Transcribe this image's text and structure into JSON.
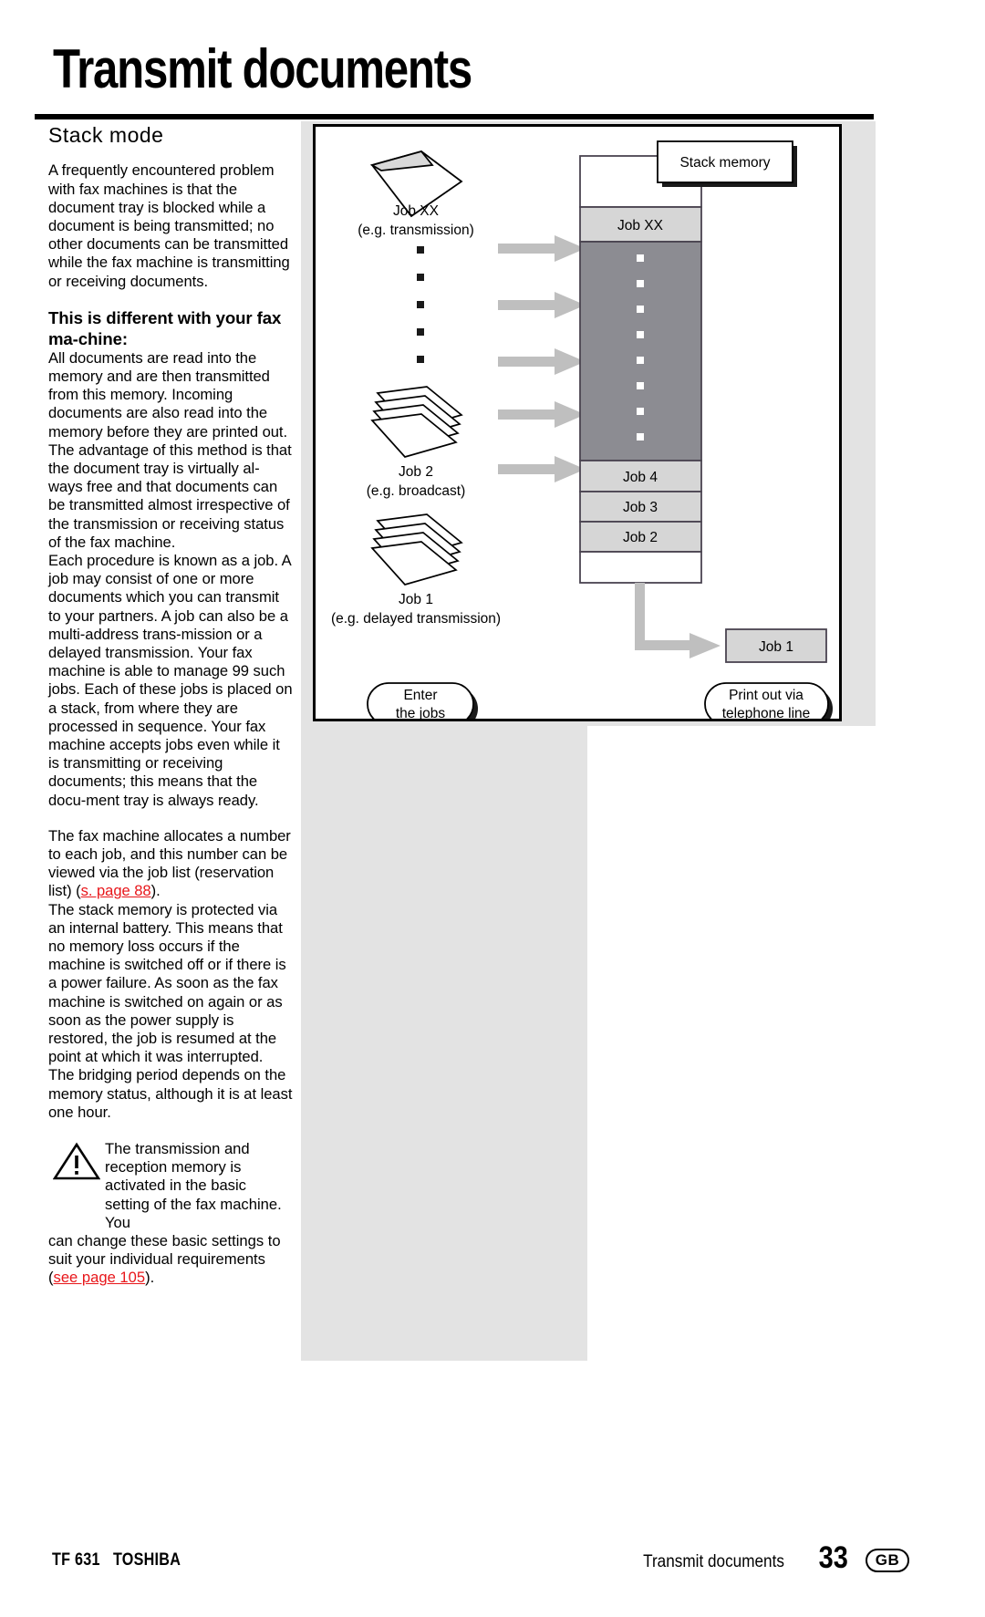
{
  "header": {
    "title": "Transmit documents"
  },
  "left_column": {
    "section_heading": "Stack mode",
    "paragraph_1": "A frequently encountered problem with fax machines is that the document tray is blocked while a document is being transmitted; no other documents can be transmitted while the fax machine is transmitting or receiving documents.",
    "sub_heading": "This is different with your fax ma-chine:",
    "paragraph_2": "All documents are read into the memory and are then transmitted from this memory. Incoming documents are also read into the memory before they are printed out. The advantage of this method is that the document tray is virtually al-ways free and that documents can be transmitted almost irrespective of the transmission or receiving status of the fax machine.",
    "paragraph_3": "Each procedure is known as a job. A job may consist of one or more documents which you can transmit to your partners. A job can also be a multi-address trans-mission or a delayed transmission. Your fax machine is able to manage 99 such jobs. Each of these jobs is placed on a stack, from where they are processed in sequence. Your fax machine accepts jobs even while it is transmitting or receiving documents; this means that the docu-ment tray is always ready.",
    "paragraph_4_before_link": "The fax machine allocates a number to each job, and this number can be viewed via the job list (reservation list) (",
    "paragraph_4_link": "s. page 88",
    "paragraph_4_after_link": ").",
    "paragraph_5": "The stack memory is protected via an internal battery. This means that no memory loss occurs if the machine is switched off or if there is a power failure. As soon as the fax machine is switched on again or as soon as the power supply is restored, the job is resumed at the point at which it was interrupted. The bridging period depends on the memory status, although it is at least one hour.",
    "warning": {
      "icon": "warning-triangle-icon",
      "text_indented": "The transmission and reception memory is activated in the basic setting of the fax machine. You",
      "text_rest_before_link": "can change these basic settings to suit your individual requirements (",
      "text_rest_link": "see page 105",
      "text_rest_after_link": ")."
    }
  },
  "diagram": {
    "stack_memory_label": "Stack memory",
    "input_jobs": [
      {
        "name": "Job XX",
        "detail": "(e.g. transmission)"
      },
      {
        "name": "Job 2",
        "detail": "(e.g. broadcast)"
      },
      {
        "name": "Job 1",
        "detail": "(e.g. delayed transmission)"
      }
    ],
    "stack_rows": [
      {
        "label": "Job XX",
        "fill": "light"
      },
      {
        "label": "",
        "fill": "dark"
      },
      {
        "label": "Job 4",
        "fill": "light"
      },
      {
        "label": "Job 3",
        "fill": "light"
      },
      {
        "label": "Job 2",
        "fill": "light"
      },
      {
        "label": "",
        "fill": "white"
      }
    ],
    "output_box_label": "Job 1",
    "callout_left_line1": "Enter",
    "callout_left_line2": "the jobs",
    "callout_right_line1": "Print out via",
    "callout_right_line2": "telephone line",
    "colors": {
      "dark_fill": "#8c8c92",
      "light_fill": "#d6d6d6",
      "arrow": "#bfbfbf",
      "border": "#4a4450"
    }
  },
  "footer": {
    "model": "TF 631",
    "brand": "TOSHIBA",
    "section": "Transmit documents",
    "page_number": "33",
    "region_badge": "GB"
  }
}
